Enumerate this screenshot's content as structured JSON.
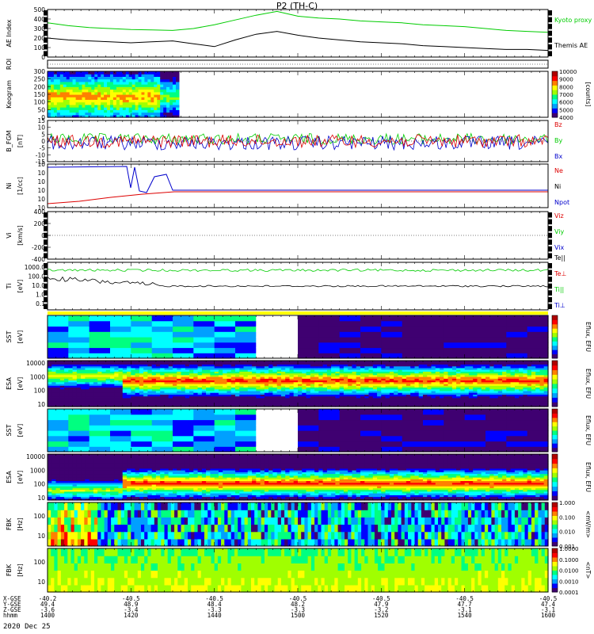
{
  "title": "P2 (TH-C)",
  "date_label": "2020 Dec 25",
  "xaxis": {
    "rows": [
      {
        "label": "X-GSE",
        "values": [
          "-40.2",
          "-40.5",
          "-40.5",
          "-40.5",
          "-40.5",
          "-40.5"
        ]
      },
      {
        "label": "Y-GSE",
        "values": [
          "49.4",
          "48.9",
          "48.4",
          "48.2",
          "47.9",
          "47.7",
          "47.4"
        ]
      },
      {
        "label": "Z-GSE",
        "values": [
          "-3.6",
          "-3.4",
          "-3.3",
          "-3.3",
          "-3.2",
          "-3.1",
          "-3.1"
        ]
      },
      {
        "label": "hhmm",
        "values": [
          "1400",
          "1420",
          "1440",
          "1500",
          "1520",
          "1540",
          "1600"
        ]
      }
    ],
    "xlabels_x_row": [
      "-40.2",
      "-40.5",
      "-40.5",
      "-40.5",
      "-40.5",
      "-40.5",
      "-40.5"
    ]
  },
  "colors": {
    "green": "#00cc00",
    "black": "#000000",
    "red": "#dd0000",
    "blue": "#0000cc",
    "yellow": "#ffff00",
    "white": "#ffffff"
  },
  "chart_data": [
    {
      "type": "line",
      "panel": "ae",
      "ylabel": "AE Index",
      "ylim": [
        0,
        500
      ],
      "yticks": [
        "0",
        "100",
        "200",
        "300",
        "400",
        "500"
      ],
      "x": [
        1400,
        1405,
        1410,
        1415,
        1420,
        1425,
        1430,
        1435,
        1440,
        1445,
        1450,
        1455,
        1500,
        1505,
        1510,
        1515,
        1520,
        1525,
        1530,
        1535,
        1540,
        1545,
        1550,
        1555,
        1600
      ],
      "series": [
        {
          "name": "Kyoto proxy AE",
          "color": "#00cc00",
          "values": [
            360,
            330,
            310,
            300,
            290,
            285,
            280,
            300,
            340,
            390,
            440,
            480,
            430,
            410,
            400,
            380,
            370,
            360,
            340,
            330,
            320,
            300,
            280,
            270,
            260
          ]
        },
        {
          "name": "Themis AE",
          "color": "#000000",
          "values": [
            200,
            180,
            170,
            160,
            150,
            160,
            170,
            140,
            110,
            180,
            240,
            270,
            230,
            200,
            180,
            160,
            150,
            140,
            120,
            110,
            100,
            90,
            80,
            80,
            70
          ]
        }
      ]
    },
    {
      "type": "line",
      "panel": "roi",
      "ylabel": "ROI"
    },
    {
      "type": "heatmap",
      "panel": "keogram",
      "ylabel": "Keogram",
      "ylim": [
        0,
        300
      ],
      "yticks": [
        "0",
        "50",
        "100",
        "150",
        "200",
        "250",
        "300"
      ],
      "colorbar": {
        "label": "[counts]",
        "ticks": [
          "4000",
          "5000",
          "6000",
          "7000",
          "8000",
          "9000",
          "10000"
        ]
      }
    },
    {
      "type": "line",
      "panel": "bfgm",
      "ylabel": "B_FGM",
      "yunit": "[nT]",
      "ylim": [
        -15,
        15
      ],
      "yticks": [
        "-15",
        "-10",
        "-5",
        "0",
        "5",
        "10",
        "15"
      ],
      "series": [
        {
          "name": "Bz",
          "color": "#dd0000"
        },
        {
          "name": "By",
          "color": "#00cc00"
        },
        {
          "name": "Bx",
          "color": "#0000cc"
        }
      ]
    },
    {
      "type": "line",
      "panel": "density",
      "ylabel": "Ni",
      "yunit": "[1/cc]",
      "yticks": [
        "10",
        "10",
        "10",
        "10",
        "10",
        "10"
      ],
      "series": [
        {
          "name": "Ne",
          "color": "#dd0000"
        },
        {
          "name": "Ni",
          "color": "#000000"
        },
        {
          "name": "Npot",
          "color": "#0000cc"
        }
      ]
    },
    {
      "type": "line",
      "panel": "velocity",
      "ylabel": "Vi",
      "yunit": "[km/s]",
      "ylim": [
        -400,
        400
      ],
      "yticks": [
        "-400",
        "-200",
        "0",
        "200",
        "400"
      ],
      "series": [
        {
          "name": "Viz",
          "color": "#dd0000"
        },
        {
          "name": "Viy",
          "color": "#00cc00"
        },
        {
          "name": "Vix",
          "color": "#0000cc"
        }
      ]
    },
    {
      "type": "line",
      "panel": "temperature",
      "ylabel": "Ti",
      "yunit": "[eV]",
      "yticks": [
        "0.1",
        "1.0",
        "10.0",
        "100.0",
        "1000.0"
      ],
      "series": [
        {
          "name": "Te||",
          "color": "#000000"
        },
        {
          "name": "Te⊥",
          "color": "#dd0000"
        },
        {
          "name": "Ti||",
          "color": "#00cc00"
        },
        {
          "name": "Ti⊥",
          "color": "#0000cc"
        }
      ]
    },
    {
      "type": "heatmap",
      "panel": "sst_e",
      "ylabel": "SST",
      "yunit": "[eV]",
      "colorbar": {
        "label": "Eflux, EFU"
      }
    },
    {
      "type": "heatmap",
      "panel": "esa_e",
      "ylabel": "ESA",
      "yunit": "[eV]",
      "yticks": [
        "10",
        "100",
        "1000",
        "10000"
      ],
      "colorbar": {
        "label": "Eflux, EFU"
      }
    },
    {
      "type": "heatmap",
      "panel": "sst_i",
      "ylabel": "SST",
      "yunit": "[eV]",
      "colorbar": {
        "label": "Eflux, EFU"
      }
    },
    {
      "type": "heatmap",
      "panel": "esa_i",
      "ylabel": "ESA",
      "yunit": "[eV]",
      "yticks": [
        "10",
        "100",
        "1000",
        "10000"
      ],
      "colorbar": {
        "label": "Eflux, EFU"
      }
    },
    {
      "type": "heatmap",
      "panel": "fbk_e",
      "ylabel": "FBK",
      "yunit": "[Hz]",
      "yticks": [
        "10",
        "100"
      ],
      "colorbar": {
        "label": "<mV/m>",
        "ticks": [
          "0.001",
          "0.010",
          "0.100",
          "1.000"
        ]
      }
    },
    {
      "type": "heatmap",
      "panel": "fbk_b",
      "ylabel": "FBK",
      "yunit": "[Hz]",
      "yticks": [
        "10",
        "100"
      ],
      "colorbar": {
        "label": "<nT>",
        "ticks": [
          "0.0001",
          "0.0010",
          "0.0100",
          "0.1000",
          "1.0000"
        ]
      }
    }
  ]
}
